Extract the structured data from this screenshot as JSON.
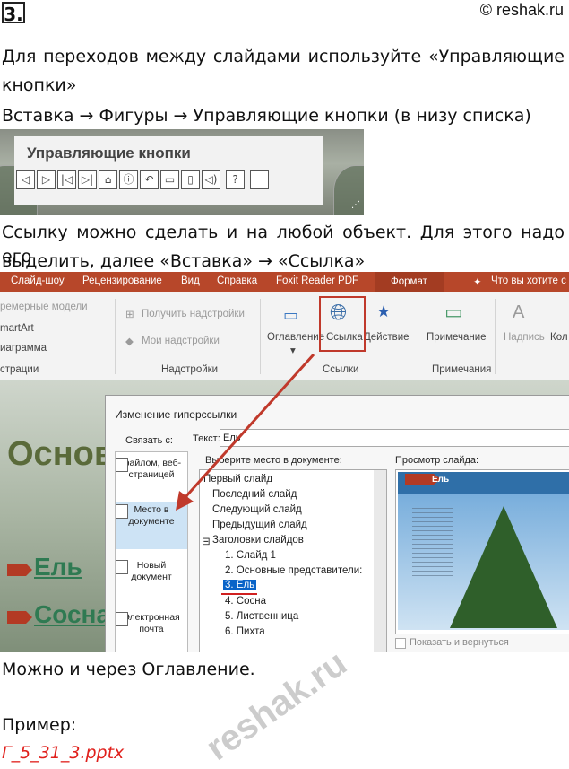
{
  "header": {
    "number": "3.",
    "site": "© reshak.ru"
  },
  "text": {
    "p1_line1": "Для переходов между слайдами используйте «Управляющие",
    "p1_line2": "кнопки»",
    "p2": "Вставка → Фигуры → Управляющие кнопки (в низу списка)",
    "p3_line1": "Ссылку можно сделать и на любой объект. Для этого надо его",
    "p3_line2": "выделить, далее «Вставка» → «Ссылка»",
    "p4": "Можно и через Оглавление.",
    "p5": "Пример:",
    "example_file": "Г_5_31_3.pptx",
    "watermark": "reshak.ru"
  },
  "shapes_panel": {
    "title": "Управляющие кнопки",
    "buttons": [
      "◁",
      "▷",
      "|◁",
      "▷|",
      "⌂",
      "ⓘ",
      "↶",
      "▭",
      "▯",
      "◁)",
      "?",
      ""
    ]
  },
  "ribbon": {
    "tabs": [
      "Слайд-шоу",
      "Рецензирование",
      "Вид",
      "Справка",
      "Foxit Reader PDF",
      "Формат",
      "Что вы хотите с"
    ],
    "left_items": [
      "ремерные модели",
      "martArt",
      "иаграмма",
      "страции"
    ],
    "addins": [
      "Получить надстройки",
      "Мои надстройки",
      "Надстройки"
    ],
    "links": [
      "Оглавление",
      "Ссылка",
      "Действие",
      "Ссылки"
    ],
    "comments": [
      "Примечание",
      "Примечания"
    ],
    "right_items": [
      "Надпись",
      "Кол"
    ]
  },
  "slide": {
    "title": "Основ",
    "link1": "Ель",
    "link2": "Сосна"
  },
  "dialog": {
    "title": "Изменение гиперссылки",
    "link_to_label": "Связать с:",
    "text_label": "Текст:",
    "text_value": "Ель",
    "place_label": "Выберите место в документе:",
    "preview_label": "Просмотр слайда:",
    "sidebar": [
      "файлом, веб-страницей",
      "Место в документе",
      "Новый документ",
      "Электронная почта"
    ],
    "tree": [
      "Первый слайд",
      "Последний слайд",
      "Следующий слайд",
      "Предыдущий слайд",
      "Заголовки слайдов",
      "1. Слайд 1",
      "2. Основные представители:",
      "3. Ель",
      "4. Сосна",
      "5. Лиственница",
      "6. Пихта"
    ],
    "preview_title": "Ель",
    "show_and_return": "Показать и вернуться"
  },
  "colors": {
    "accent_red": "#c0392b",
    "example_red": "#e0201c",
    "ribbon_red": "#b7472a"
  }
}
